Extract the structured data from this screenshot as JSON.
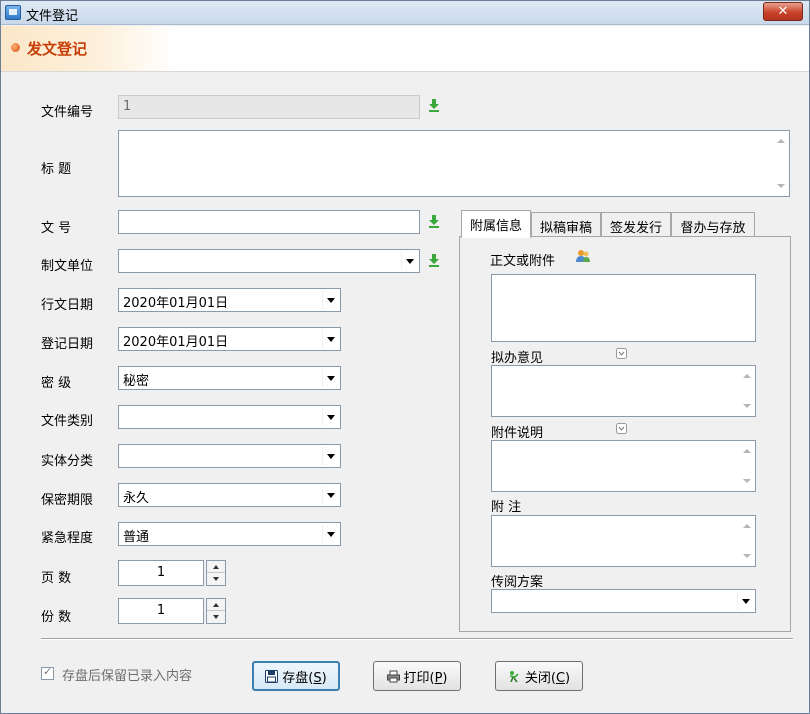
{
  "window": {
    "title": "文件登记",
    "close_label": "✕"
  },
  "banner": {
    "title": "发文登记"
  },
  "form": {
    "file_no": {
      "label": "文件编号",
      "value": "1"
    },
    "title": {
      "label": "标  题",
      "value": ""
    },
    "doc_no": {
      "label": "文  号",
      "value": ""
    },
    "issuing_unit": {
      "label": "制文单位",
      "value": ""
    },
    "issue_date": {
      "label": "行文日期",
      "value": "2020年01月01日"
    },
    "register_date": {
      "label": "登记日期",
      "value": "2020年01月01日"
    },
    "secrecy": {
      "label": "密  级",
      "value": "秘密"
    },
    "category": {
      "label": "文件类别",
      "value": ""
    },
    "entity_class": {
      "label": "实体分类",
      "value": ""
    },
    "retention": {
      "label": "保密期限",
      "value": "永久"
    },
    "urgency": {
      "label": "紧急程度",
      "value": "普通"
    },
    "pages": {
      "label": "页  数",
      "value": "1"
    },
    "copies": {
      "label": "份  数",
      "value": "1"
    }
  },
  "tabs": [
    {
      "label": "附属信息",
      "active": true
    },
    {
      "label": "拟稿审稿",
      "active": false
    },
    {
      "label": "签发发行",
      "active": false
    },
    {
      "label": "督办与存放",
      "active": false
    }
  ],
  "attach_panel": {
    "body_or_attachment": "正文或附件",
    "draft_opinion": "拟办意见",
    "attachment_note": "附件说明",
    "remarks": "附  注",
    "circulation_plan": "传阅方案",
    "circulation_value": ""
  },
  "footer": {
    "keep_checkbox_label": "存盘后保留已录入内容",
    "keep_checked": true,
    "save": {
      "text": "存盘(",
      "key": "S",
      "close": ")"
    },
    "print": {
      "text": "打印(",
      "key": "P",
      "close": ")"
    },
    "close": {
      "text": "关闭(",
      "key": "C",
      "close": ")"
    }
  },
  "colors": {
    "accent_orange": "#c63e06",
    "lookup_green": "#3aa83a",
    "titlebar": "#c9d8ea",
    "close_red": "#c8442c",
    "default_button_border": "#3c7fb1"
  },
  "icons": {
    "lookup": "green-down-arrow-icon",
    "attach": "people-icon",
    "save": "floppy-disk-icon",
    "print": "printer-icon",
    "close": "exit-icon"
  }
}
